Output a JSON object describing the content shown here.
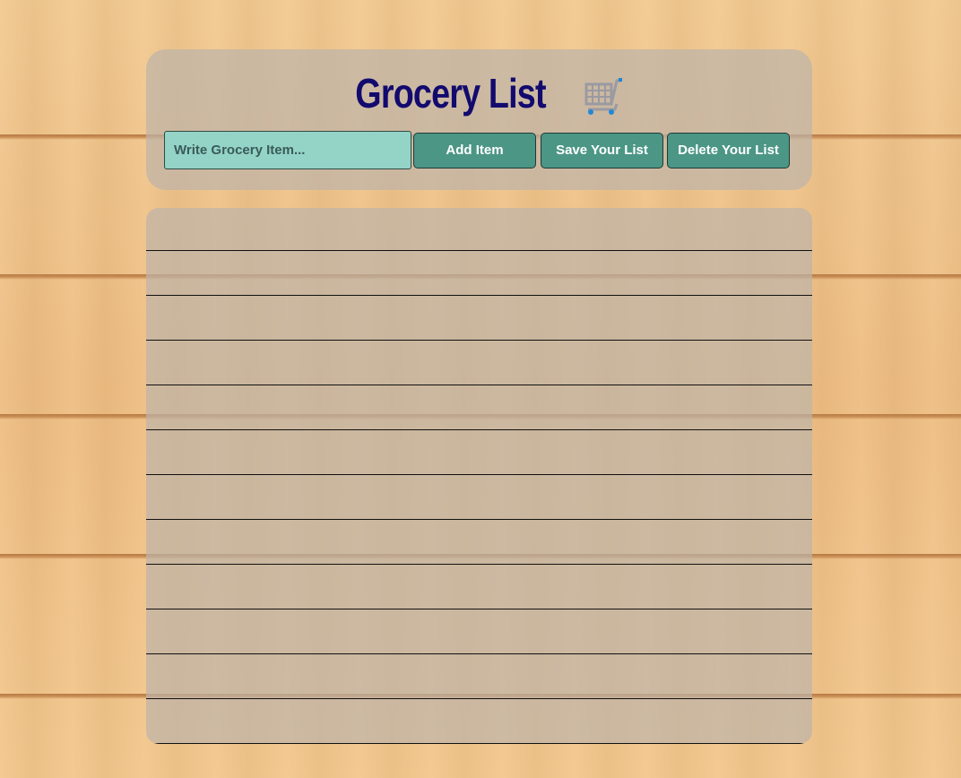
{
  "header": {
    "title": "Grocery List",
    "cart_icon": "shopping-cart-icon"
  },
  "form": {
    "input_placeholder": "Write Grocery Item...",
    "input_value": "",
    "add_label": "Add Item",
    "save_label": "Save Your List",
    "delete_label": "Delete Your List"
  },
  "list": {
    "items": [
      "",
      "",
      "",
      "",
      "",
      "",
      "",
      "",
      "",
      "",
      "",
      ""
    ]
  },
  "colors": {
    "title": "#120a6e",
    "button": "#4c9686",
    "input": "#93d4c7"
  }
}
